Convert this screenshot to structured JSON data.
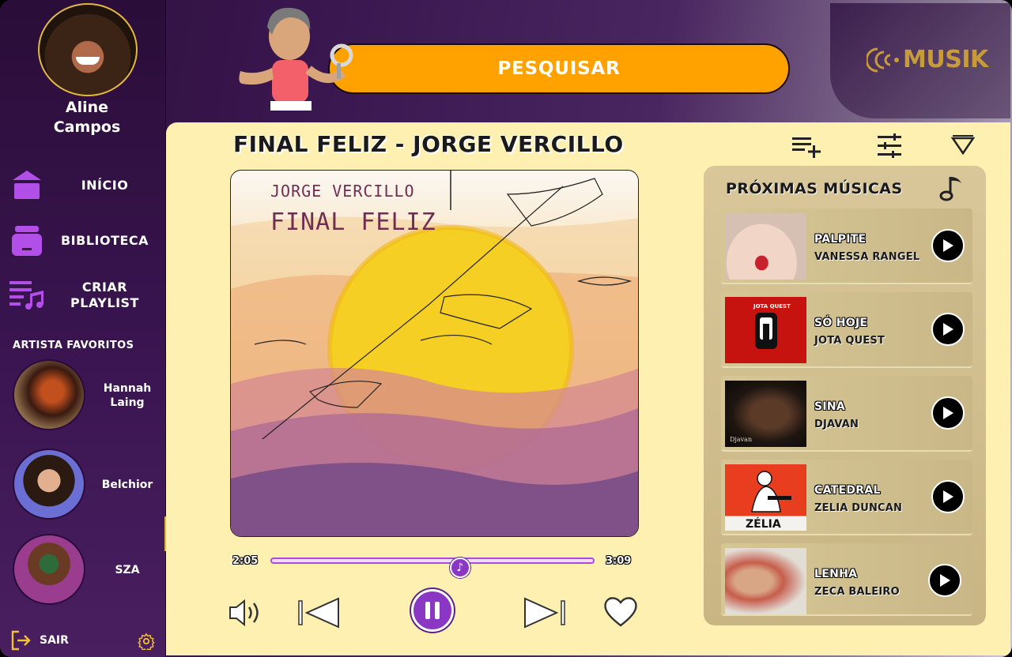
{
  "user": {
    "name_line1": "Aline",
    "name_line2": "Campos"
  },
  "nav": [
    {
      "label": "INÍCIO",
      "icon": "home-icon"
    },
    {
      "label": "BIBLIOTECA",
      "icon": "library-icon"
    },
    {
      "label_line1": "CRIAR",
      "label_line2": "PLAYLIST",
      "icon": "playlist-add-icon"
    }
  ],
  "favorites": {
    "title": "ARTISTA FAVORITOS",
    "artists": [
      {
        "name_line1": "Hannah",
        "name_line2": "Laing"
      },
      {
        "name": "Belchior"
      },
      {
        "name": "SZA"
      }
    ]
  },
  "footer": {
    "logout_label": "SAIR"
  },
  "search": {
    "label": "PESQUISAR"
  },
  "logo": {
    "text": "MUSIK"
  },
  "now_playing": {
    "title": "FINAL FELIZ - JORGE VERCILLO",
    "cover_artist": "JORGE VERCILLO",
    "cover_album": "FINAL FELIZ",
    "elapsed": "2:05",
    "duration": "3:09",
    "progress_fraction": 0.58
  },
  "queue": {
    "title": "PRÓXIMAS MÚSICAS",
    "items": [
      {
        "title": "PALPITE",
        "artist": "VANESSA RANGEL"
      },
      {
        "title": "SÓ HOJE",
        "artist": "JOTA QUEST",
        "cover_text": "JOTA QUEST"
      },
      {
        "title": "SINA",
        "artist": "DJAVAN",
        "cover_text": "Djavan"
      },
      {
        "title": "CATEDRAL",
        "artist": "ZELIA DUNCAN",
        "cover_text": "ZÉLIA"
      },
      {
        "title": "LENHA",
        "artist": "ZECA BALEIRO"
      }
    ]
  },
  "colors": {
    "accent": "#ffa200",
    "purple": "#8a37c4",
    "panel": "#fdf0b1",
    "sidebar": "#2a0d38"
  }
}
